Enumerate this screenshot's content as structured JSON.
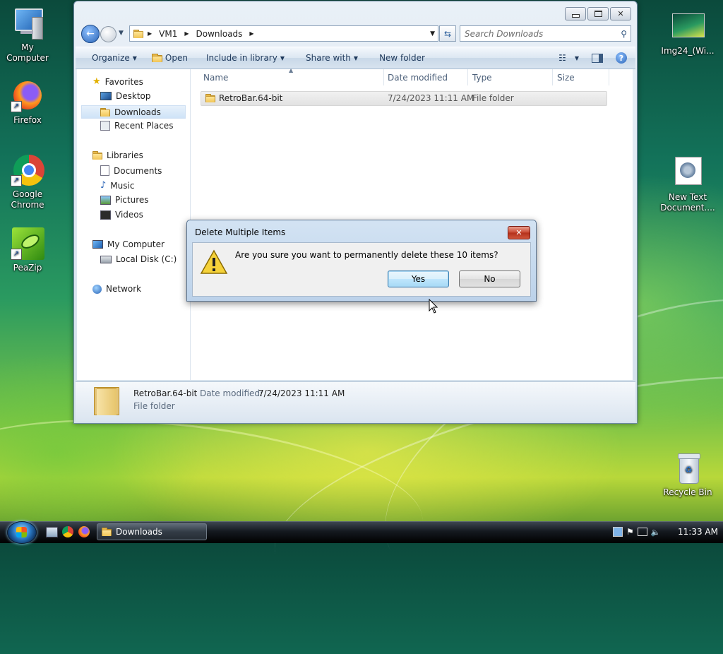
{
  "desktop": {
    "icons": [
      {
        "label": "My Computer",
        "icon": "computer-icon"
      },
      {
        "label": "Firefox",
        "icon": "firefox-icon"
      },
      {
        "label": "Google Chrome",
        "icon": "chrome-icon"
      },
      {
        "label": "PeaZip",
        "icon": "peazip-icon"
      },
      {
        "label": "Img24_(Wi...",
        "icon": "image-file-icon"
      },
      {
        "label": "New Text Document....",
        "icon": "text-document-icon"
      },
      {
        "label": "Recycle Bin",
        "icon": "recycle-bin-icon"
      }
    ]
  },
  "explorer": {
    "breadcrumb": [
      "VM1",
      "Downloads"
    ],
    "search_placeholder": "Search Downloads",
    "toolbar": {
      "organize": "Organize",
      "open": "Open",
      "include_in_library": "Include in library",
      "share_with": "Share with",
      "new_folder": "New folder"
    },
    "nav": {
      "favorites": "Favorites",
      "desktop": "Desktop",
      "downloads": "Downloads",
      "recent_places": "Recent Places",
      "libraries": "Libraries",
      "documents": "Documents",
      "music": "Music",
      "pictures": "Pictures",
      "videos": "Videos",
      "my_computer": "My Computer",
      "local_disk": "Local Disk (C:)",
      "network": "Network"
    },
    "columns": {
      "name": "Name",
      "date_modified": "Date modified",
      "type": "Type",
      "size": "Size"
    },
    "files": [
      {
        "name": "RetroBar.64-bit",
        "date_modified": "7/24/2023 11:11 AM",
        "type": "File folder",
        "size": ""
      }
    ],
    "details": {
      "name": "RetroBar.64-bit",
      "date_label": "Date modified:",
      "date_value": "7/24/2023 11:11 AM",
      "type": "File folder"
    }
  },
  "dialog": {
    "title": "Delete Multiple Items",
    "message": "Are you sure you want to permanently delete these 10 items?",
    "yes": "Yes",
    "no": "No",
    "close": "✕"
  },
  "taskbar": {
    "task_label": "Downloads",
    "clock": "11:33 AM"
  }
}
